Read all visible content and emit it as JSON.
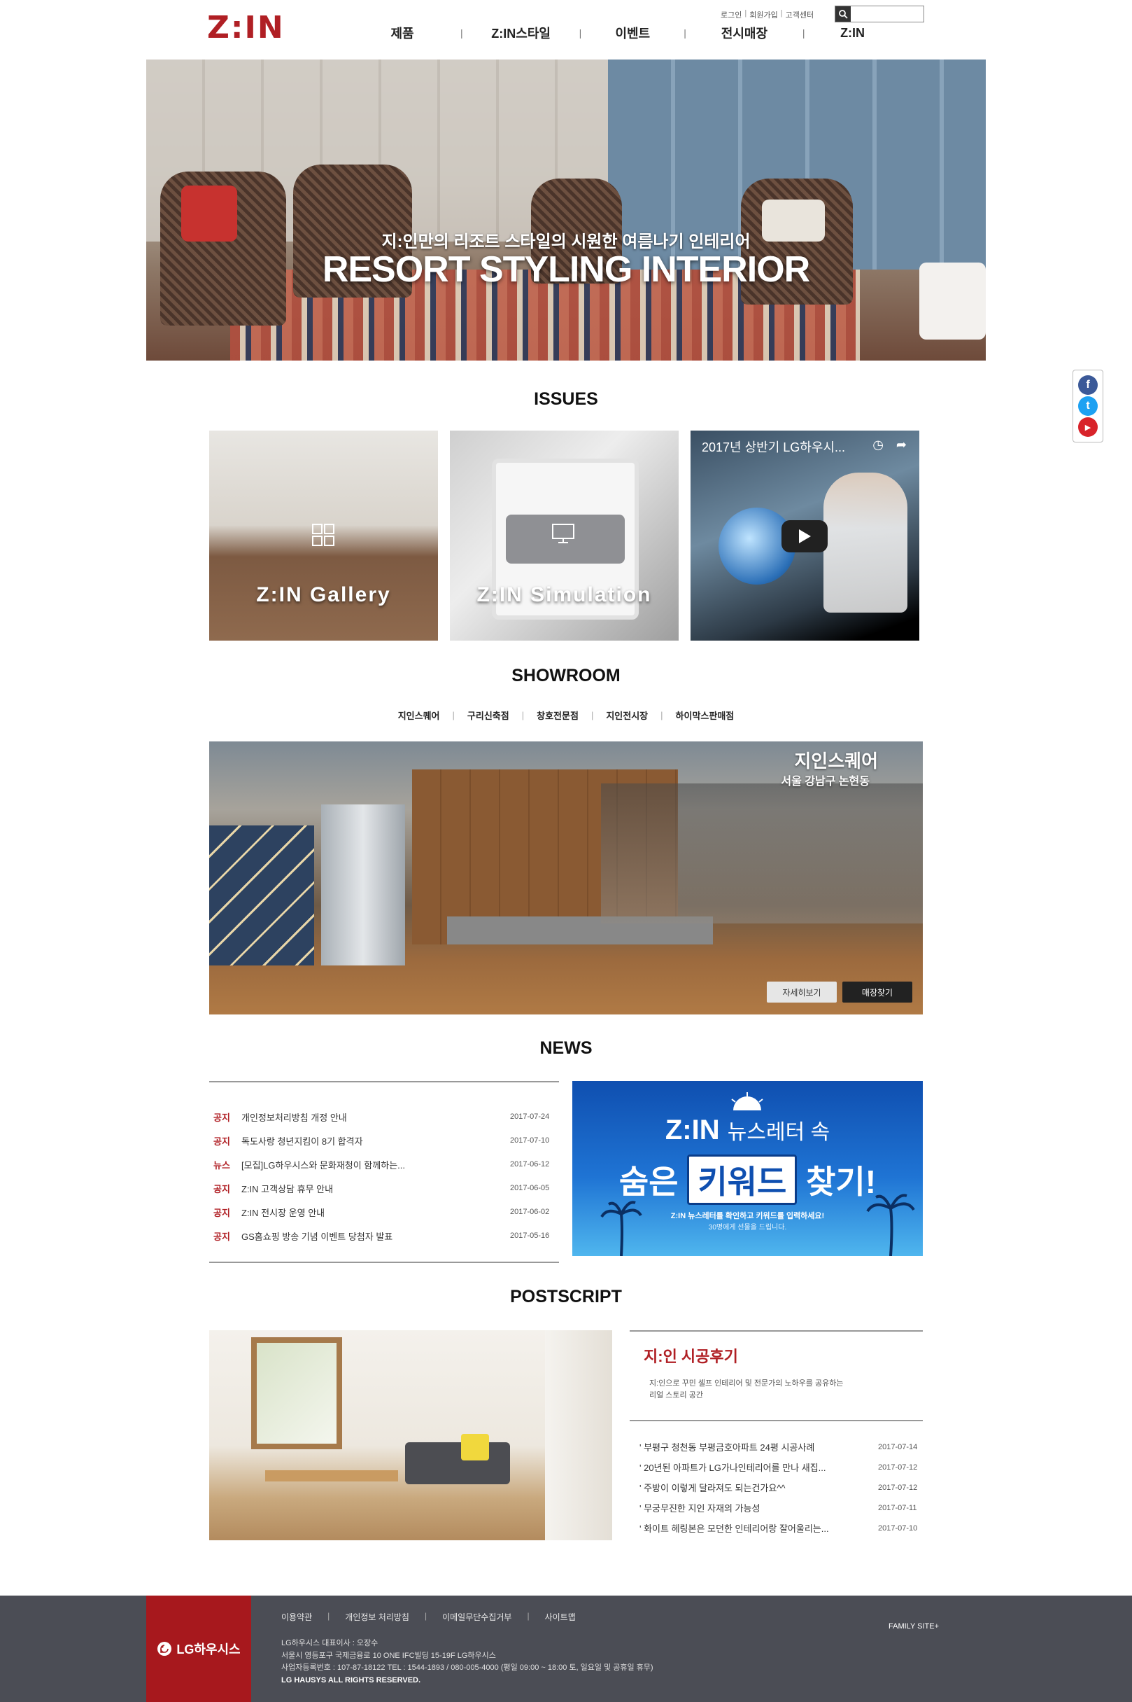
{
  "header": {
    "logo": "Z:IN",
    "util": [
      "로그인",
      "회원가입",
      "고객센터"
    ],
    "search_placeholder": "",
    "nav": [
      "제품",
      "Z:IN스타일",
      "이벤트",
      "전시매장",
      "Z:IN"
    ]
  },
  "hero": {
    "subtitle": "지:인만의 리조트 스타일의 시원한 여름나기 인테리어",
    "title": "RESORT STYLING INTERIOR"
  },
  "issues": {
    "title": "ISSUES",
    "cards": [
      {
        "caption": "Z:IN Gallery"
      },
      {
        "caption": "Z:IN Simulation"
      },
      {
        "video_title": "2017년 상반기 LG하우시..."
      }
    ]
  },
  "showroom": {
    "title": "SHOWROOM",
    "tabs": [
      "지인스퀘어",
      "구리신축점",
      "창호전문점",
      "지인전시장",
      "하이막스판매점"
    ],
    "name": "지인스퀘어",
    "address": "서울 강남구 논현동",
    "detail_button": "자세히보기",
    "find_button": "매장찾기"
  },
  "news": {
    "title": "NEWS",
    "items": [
      {
        "tag": "공지",
        "title": "개인정보처리방침 개정 안내",
        "date": "2017-07-24"
      },
      {
        "tag": "공지",
        "title": "독도사랑 청년지킴이 8기 합격자",
        "date": "2017-07-10"
      },
      {
        "tag": "뉴스",
        "title": "[모집]LG하우시스와 문화재청이 함께하는...",
        "date": "2017-06-12"
      },
      {
        "tag": "공지",
        "title": "Z:IN 고객상담 휴무 안내",
        "date": "2017-06-05"
      },
      {
        "tag": "공지",
        "title": "Z:IN 전시장 운영 안내",
        "date": "2017-06-02"
      },
      {
        "tag": "공지",
        "title": "GS홈쇼핑 방송 기념 이벤트 당첨자 발표",
        "date": "2017-05-16"
      }
    ],
    "banner": {
      "line1_logo": "Z:IN",
      "line1_text": "뉴스레터 속",
      "line2_a": "숨은",
      "line2_kw": "키워드",
      "line2_b": "찾기!",
      "line3": "Z:IN 뉴스레터를 확인하고 키워드를 입력하세요!",
      "line4": "30명에게 선물을 드립니다."
    }
  },
  "postscript": {
    "title": "POSTSCRIPT",
    "box_title": "지:인 시공후기",
    "box_desc": "지:인으로 꾸민 셀프 인테리어 및 전문가의 노하우를 공유하는 리얼 스토리 공간",
    "items": [
      {
        "title": "' 부평구 청천동 부평금호아파트 24평 시공사례",
        "date": "2017-07-14"
      },
      {
        "title": "' 20년된 아파트가 LG가나인테리어를 만나 새집...",
        "date": "2017-07-12"
      },
      {
        "title": "' 주방이 이렇게 달라져도 되는건가요^^",
        "date": "2017-07-12"
      },
      {
        "title": "' 무궁무진한 지인 자재의 가능성",
        "date": "2017-07-11"
      },
      {
        "title": "' 화이트 헤링본은 모던한 인테리어랑 잘어울리는...",
        "date": "2017-07-10"
      }
    ]
  },
  "sns": [
    "f",
    "t",
    "▶"
  ],
  "footer": {
    "brand": "LG하우시스",
    "links": [
      "이용약관",
      "개인정보 처리방침",
      "이메일무단수집거부",
      "사이트맵"
    ],
    "ceo": "LG하우시스 대표이사 : 오장수",
    "address": "서울시 영등포구 국제금융로 10 ONE IFC빌딩 15-19F LG하우시스",
    "biz": "사업자등록번호 : 107-87-18122 TEL : 1544-1893 / 080-005-4000 (평일 09:00 ~ 18:00 토, 일요일 및 공휴일 휴무)",
    "copyright": "LG HAUSYS ALL RIGHTS RESERVED.",
    "family_site": "FAMILY SITE+"
  },
  "colors": {
    "brand_red": "#b01f24",
    "footer_bg": "#4b4d55",
    "footer_brand_bg": "#a7181d",
    "facebook": "#3b5998",
    "twitter": "#1da1f2",
    "youtube": "#d8232a"
  }
}
